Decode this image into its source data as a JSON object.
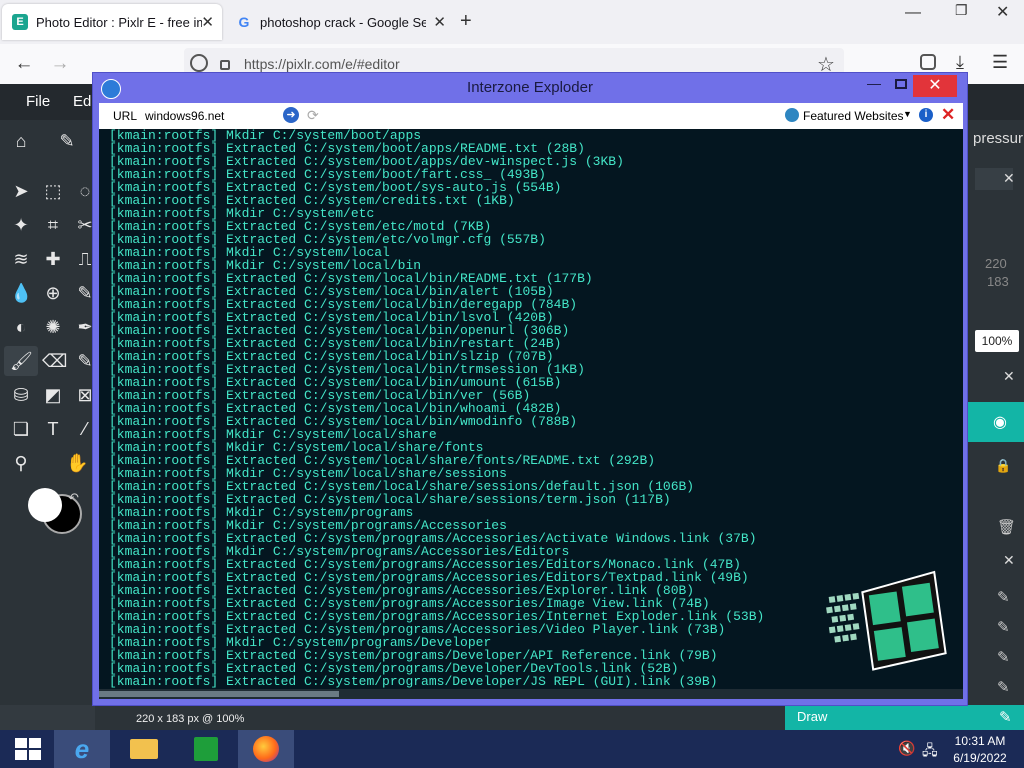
{
  "browser": {
    "tabs": [
      {
        "title": "Photo Editor : Pixlr E - free imag",
        "icon": "pixlr-e-icon"
      },
      {
        "title": "photoshop crack - Google Searc",
        "icon": "google-icon"
      }
    ],
    "url": "https://pixlr.com/e/#editor"
  },
  "pixlr": {
    "menu": [
      "File",
      "Ed"
    ],
    "right_panel": {
      "pressure_label": "pressur",
      "width": "220",
      "height": "183",
      "zoom": "100%"
    },
    "status": "220 x 183 px @ 100%",
    "draw_label": "Draw"
  },
  "window": {
    "title": "Interzone Exploder",
    "url_label": "URL",
    "url_value": "windows96.net",
    "featured": "Featured Websites",
    "terminal_lines": [
      "[kmain:rootfs] Mkdir C:/system/boot/apps",
      "[kmain:rootfs] Extracted C:/system/boot/apps/README.txt (28B)",
      "[kmain:rootfs] Extracted C:/system/boot/apps/dev-winspect.js (3KB)",
      "[kmain:rootfs] Extracted C:/system/boot/fart.css_ (493B)",
      "[kmain:rootfs] Extracted C:/system/boot/sys-auto.js (554B)",
      "[kmain:rootfs] Extracted C:/system/credits.txt (1KB)",
      "[kmain:rootfs] Mkdir C:/system/etc",
      "[kmain:rootfs] Extracted C:/system/etc/motd (7KB)",
      "[kmain:rootfs] Extracted C:/system/etc/volmgr.cfg (557B)",
      "[kmain:rootfs] Mkdir C:/system/local",
      "[kmain:rootfs] Mkdir C:/system/local/bin",
      "[kmain:rootfs] Extracted C:/system/local/bin/README.txt (177B)",
      "[kmain:rootfs] Extracted C:/system/local/bin/alert (105B)",
      "[kmain:rootfs] Extracted C:/system/local/bin/deregapp (784B)",
      "[kmain:rootfs] Extracted C:/system/local/bin/lsvol (420B)",
      "[kmain:rootfs] Extracted C:/system/local/bin/openurl (306B)",
      "[kmain:rootfs] Extracted C:/system/local/bin/restart (24B)",
      "[kmain:rootfs] Extracted C:/system/local/bin/slzip (707B)",
      "[kmain:rootfs] Extracted C:/system/local/bin/trmsession (1KB)",
      "[kmain:rootfs] Extracted C:/system/local/bin/umount (615B)",
      "[kmain:rootfs] Extracted C:/system/local/bin/ver (56B)",
      "[kmain:rootfs] Extracted C:/system/local/bin/whoami (482B)",
      "[kmain:rootfs] Extracted C:/system/local/bin/wmodinfo (788B)",
      "[kmain:rootfs] Mkdir C:/system/local/share",
      "[kmain:rootfs] Mkdir C:/system/local/share/fonts",
      "[kmain:rootfs] Extracted C:/system/local/share/fonts/README.txt (292B)",
      "[kmain:rootfs] Mkdir C:/system/local/share/sessions",
      "[kmain:rootfs] Extracted C:/system/local/share/sessions/default.json (106B)",
      "[kmain:rootfs] Extracted C:/system/local/share/sessions/term.json (117B)",
      "[kmain:rootfs] Mkdir C:/system/programs",
      "[kmain:rootfs] Mkdir C:/system/programs/Accessories",
      "[kmain:rootfs] Extracted C:/system/programs/Accessories/Activate Windows.link (37B)",
      "[kmain:rootfs] Mkdir C:/system/programs/Accessories/Editors",
      "[kmain:rootfs] Extracted C:/system/programs/Accessories/Editors/Monaco.link (47B)",
      "[kmain:rootfs] Extracted C:/system/programs/Accessories/Editors/Textpad.link (49B)",
      "[kmain:rootfs] Extracted C:/system/programs/Accessories/Explorer.link (80B)",
      "[kmain:rootfs] Extracted C:/system/programs/Accessories/Image View.link (74B)",
      "[kmain:rootfs] Extracted C:/system/programs/Accessories/Internet Exploder.link (53B)",
      "[kmain:rootfs] Extracted C:/system/programs/Accessories/Video Player.link (73B)",
      "[kmain:rootfs] Mkdir C:/system/programs/Developer",
      "[kmain:rootfs] Extracted C:/system/programs/Developer/API Reference.link (79B)",
      "[kmain:rootfs] Extracted C:/system/programs/Developer/DevTools.link (52B)",
      "[kmain:rootfs] Extracted C:/system/programs/Developer/JS REPL (GUI).link (39B)"
    ]
  },
  "taskbar": {
    "time": "10:31 AM",
    "date": "6/19/2022"
  },
  "colors": {
    "terminal_text": "#44e6c8",
    "terminal_bg": "#041620",
    "window_frame": "#7070e8",
    "pixlr_accent": "#13b5a6"
  }
}
